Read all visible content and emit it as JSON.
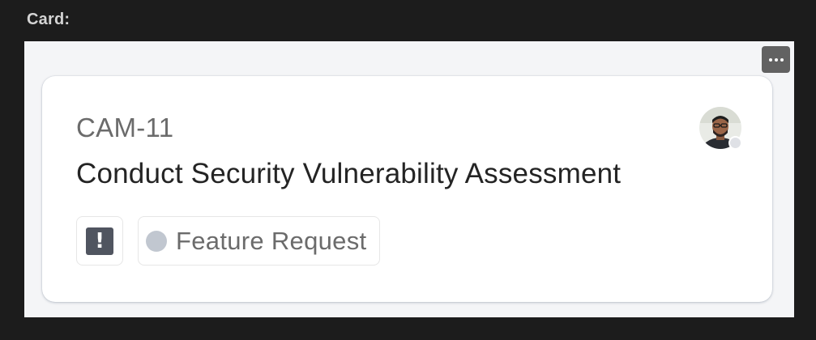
{
  "section": {
    "label": "Card:"
  },
  "card": {
    "key": "CAM-11",
    "title": "Conduct Security Vulnerability Assessment",
    "priority_symbol": "!",
    "type_label": "Feature Request",
    "type_dot_color": "#c1c7d0",
    "priority_icon_color": "#505560"
  },
  "menu": {
    "more_icon": "ellipsis-horizontal-icon"
  }
}
